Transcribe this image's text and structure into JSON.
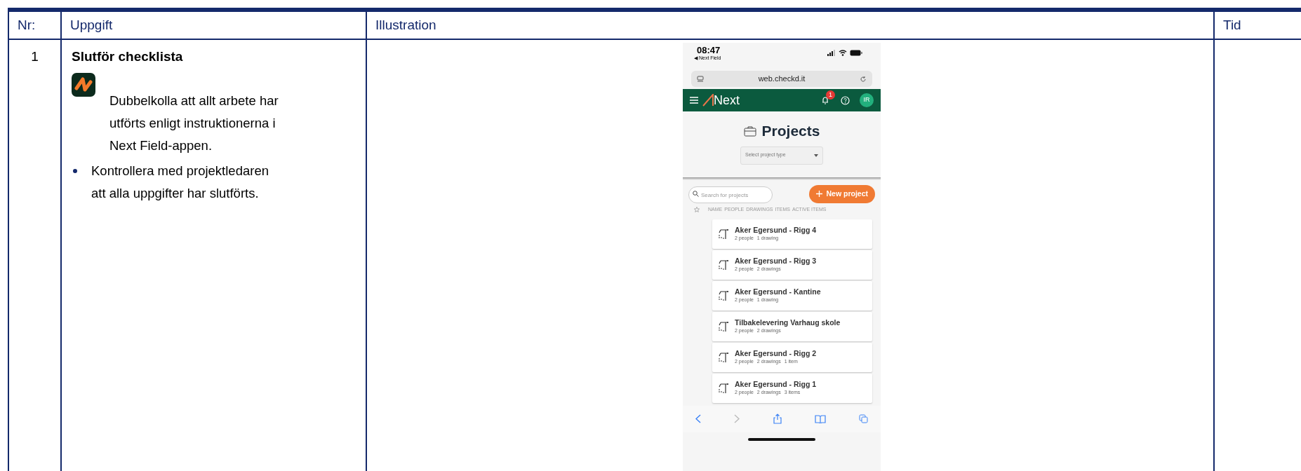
{
  "table": {
    "columns": [
      "Nr:",
      "Uppgift",
      "Illustration",
      "Tid"
    ],
    "rows": [
      {
        "nr": "1",
        "title": "Slutför checklista",
        "app_note": "Dubbelkolla att allt arbete har utförts enligt instruktionerna i Next Field-appen.",
        "bullets": [
          "Kontrollera med projektledaren att alla uppgifter har slutförts."
        ],
        "illustration": {
          "status_bar": {
            "time": "08:47",
            "back_label": "◀ Next Field"
          },
          "url": "web.checkd.it",
          "app_header": {
            "logo": "Next",
            "notification_count": "1",
            "avatar": "IR"
          },
          "page_title": "Projects",
          "project_type_select": {
            "placeholder": "Select project type"
          },
          "search": {
            "placeholder": "Search for projects"
          },
          "new_project_button": "New project",
          "list_columns": [
            "NAME",
            "PEOPLE",
            "DRAWINGS",
            "ITEMS",
            "ACTIVE ITEMS"
          ],
          "projects": [
            {
              "name": "Aker Egersund - Rigg 4",
              "details": [
                "2 people",
                "1 drawing"
              ]
            },
            {
              "name": "Aker Egersund - Rigg 3",
              "details": [
                "2 people",
                "2 drawings"
              ]
            },
            {
              "name": "Aker Egersund - Kantine",
              "details": [
                "2 people",
                "1 drawing"
              ]
            },
            {
              "name": "Tilbakelevering Varhaug skole",
              "details": [
                "2 people",
                "2 drawings"
              ]
            },
            {
              "name": "Aker Egersund - Rigg 2",
              "details": [
                "2 people",
                "2 drawings",
                "1 item"
              ]
            },
            {
              "name": "Aker Egersund - Rigg 1",
              "details": [
                "2 people",
                "2 drawings",
                "3 items"
              ]
            }
          ]
        },
        "tid": ""
      }
    ]
  }
}
